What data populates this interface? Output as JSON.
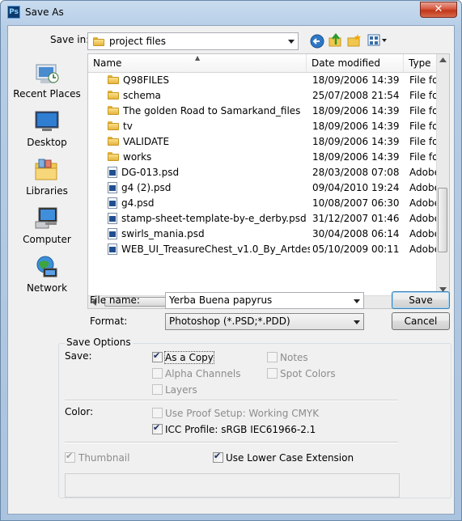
{
  "window": {
    "title": "Save As",
    "close_glyph": "✕",
    "app_icon_label": "Ps"
  },
  "top": {
    "save_in_label": "Save in:",
    "save_in_value": "project files"
  },
  "places": [
    {
      "label": "Recent Places",
      "icon": "recent-places-icon"
    },
    {
      "label": "Desktop",
      "icon": "desktop-icon"
    },
    {
      "label": "Libraries",
      "icon": "libraries-icon"
    },
    {
      "label": "Computer",
      "icon": "computer-icon"
    },
    {
      "label": "Network",
      "icon": "network-icon"
    }
  ],
  "list": {
    "columns": [
      "Name",
      "Date modified",
      "Type"
    ],
    "rows": [
      {
        "name": "Q98FILES",
        "date": "18/09/2006 14:39",
        "type": "File fol",
        "kind": "folder"
      },
      {
        "name": "schema",
        "date": "25/07/2008 21:54",
        "type": "File fol",
        "kind": "folder"
      },
      {
        "name": "The golden Road to Samarkand_files",
        "date": "18/09/2006 14:39",
        "type": "File fol",
        "kind": "folder"
      },
      {
        "name": "tv",
        "date": "18/09/2006 14:39",
        "type": "File fol",
        "kind": "folder"
      },
      {
        "name": "VALIDATE",
        "date": "18/09/2006 14:39",
        "type": "File fol",
        "kind": "folder"
      },
      {
        "name": "works",
        "date": "18/09/2006 14:39",
        "type": "File fol",
        "kind": "folder"
      },
      {
        "name": "DG-013.psd",
        "date": "28/03/2008 07:08",
        "type": "Adobe",
        "kind": "psd"
      },
      {
        "name": "g4 (2).psd",
        "date": "09/04/2010 19:24",
        "type": "Adobe",
        "kind": "psd"
      },
      {
        "name": "g4.psd",
        "date": "10/08/2007 06:30",
        "type": "Adobe",
        "kind": "psd"
      },
      {
        "name": "stamp-sheet-template-by-e_derby.psd",
        "date": "31/12/2007 01:46",
        "type": "Adobe",
        "kind": "psd"
      },
      {
        "name": "swirls_mania.psd",
        "date": "30/04/2008 06:14",
        "type": "Adobe",
        "kind": "psd"
      },
      {
        "name": "WEB_UI_TreasureChest_v1.0_By_Artdesig...",
        "date": "05/10/2009 00:11",
        "type": "Adobe",
        "kind": "psd"
      }
    ]
  },
  "filename": {
    "label": "File name:",
    "value": "Yerba Buena papyrus"
  },
  "format": {
    "label": "Format:",
    "value": "Photoshop (*.PSD;*.PDD)"
  },
  "buttons": {
    "save": "Save",
    "cancel": "Cancel"
  },
  "options": {
    "group_title": "Save Options",
    "save_label": "Save:",
    "as_a_copy": {
      "label": "As a Copy",
      "checked": true
    },
    "notes": {
      "label": "Notes",
      "checked": false
    },
    "alpha_channels": {
      "label": "Alpha Channels",
      "checked": false
    },
    "spot_colors": {
      "label": "Spot Colors",
      "checked": false
    },
    "layers": {
      "label": "Layers",
      "checked": false
    },
    "color_label": "Color:",
    "use_proof_setup": {
      "label": "Use Proof Setup:  Working CMYK",
      "checked": false
    },
    "icc_profile": {
      "label": "ICC Profile:  sRGB IEC61966-2.1",
      "checked": true
    },
    "thumbnail": {
      "label": "Thumbnail",
      "checked": true
    },
    "lower_case_ext": {
      "label": "Use Lower Case Extension",
      "checked": true
    }
  }
}
